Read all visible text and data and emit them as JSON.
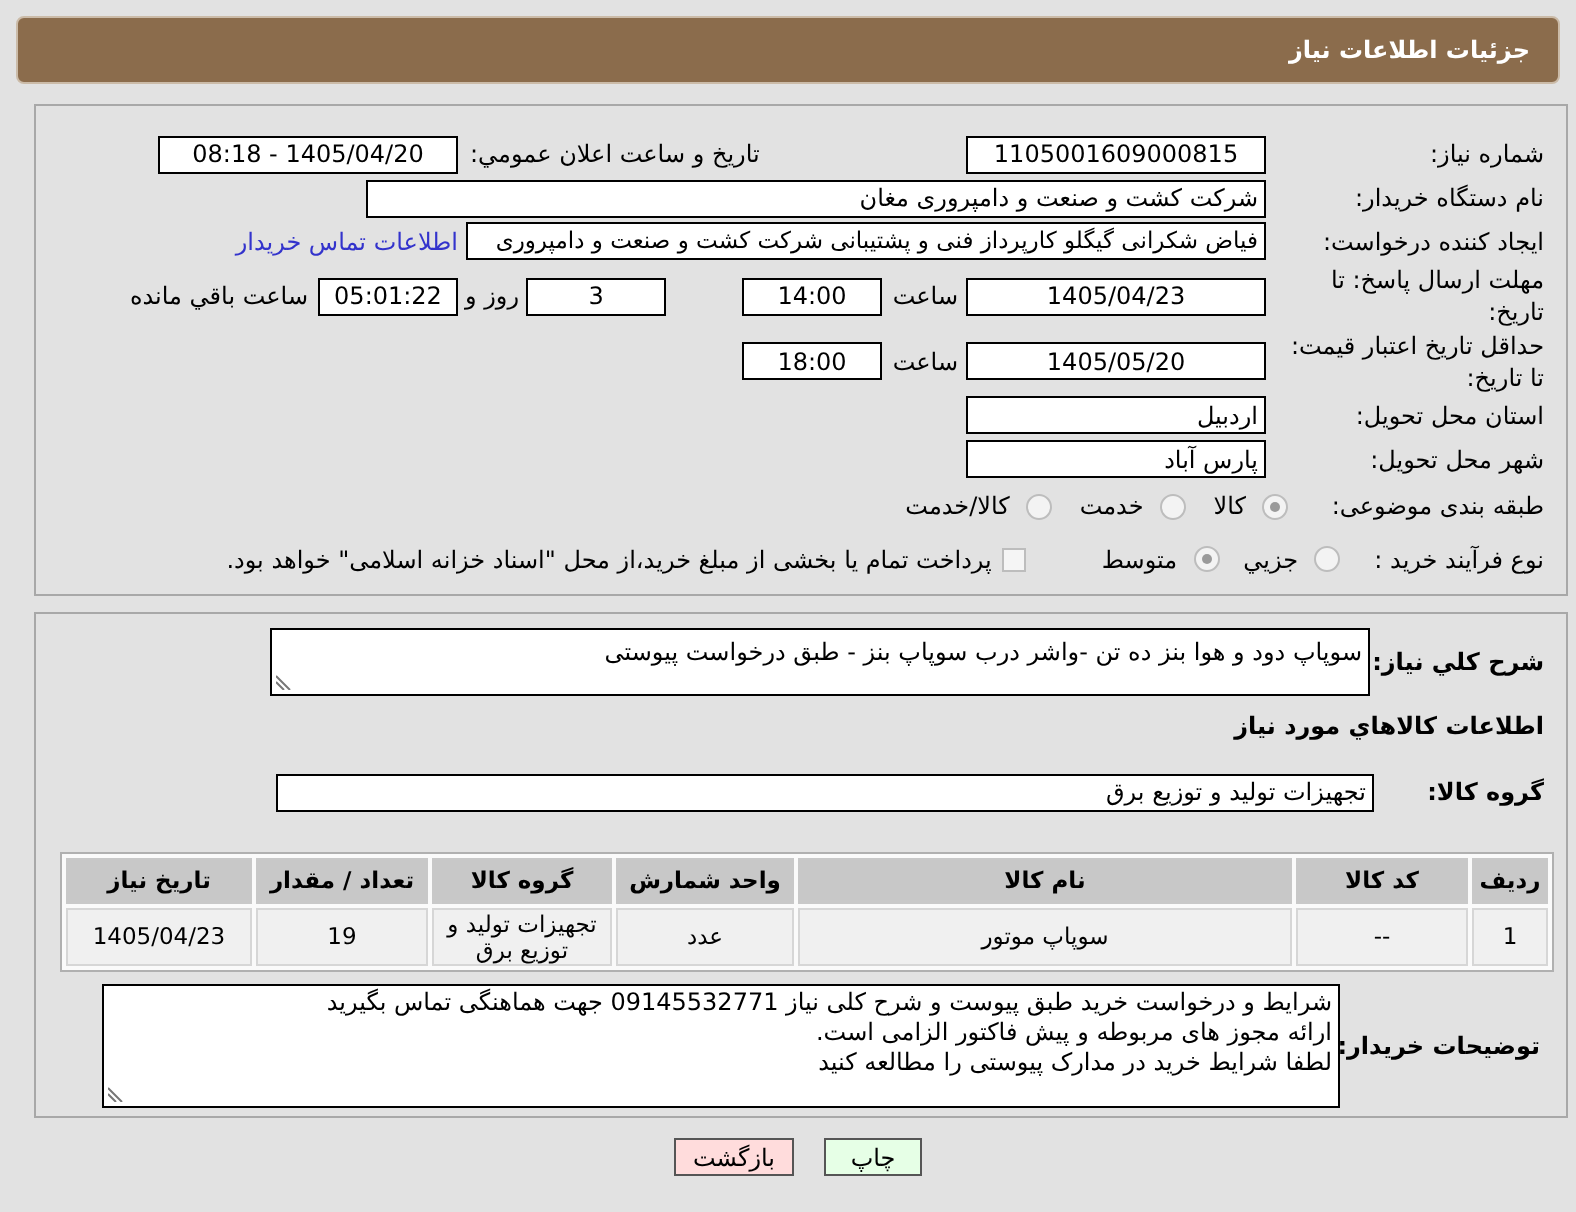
{
  "header": {
    "title": "جزئیات اطلاعات نیاز"
  },
  "details": {
    "need_number": {
      "label": "شماره نیاز:",
      "value": "1105001609000815"
    },
    "announce": {
      "label": "تاریخ و ساعت اعلان عمومي:",
      "value": "1405/04/20 - 08:18"
    },
    "buyer_org": {
      "label": "نام دستگاه خریدار:",
      "value": "شرکت کشت و صنعت و دامپروری مغان"
    },
    "requester": {
      "label": "ایجاد کننده درخواست:",
      "value": "فیاض شکرانی گیگلو کارپرداز فنی و پشتیبانی شرکت کشت و صنعت و دامپروری",
      "link": "اطلاعات تماس خریدار"
    },
    "reply_deadline": {
      "label": "مهلت ارسال پاسخ: تا تاریخ:",
      "date": "1405/04/23",
      "time_label": "ساعت",
      "time": "14:00",
      "days": "3",
      "days_label": "روز و",
      "remaining": "05:01:22",
      "remaining_label": "ساعت باقي مانده"
    },
    "price_validity": {
      "label": "حداقل تاریخ اعتبار قیمت: تا تاریخ:",
      "date": "1405/05/20",
      "time_label": "ساعت",
      "time": "18:00"
    },
    "province": {
      "label": "استان محل تحویل:",
      "value": "اردبیل"
    },
    "city": {
      "label": "شهر محل تحویل:",
      "value": "پارس آباد"
    },
    "category": {
      "label": "طبقه بندی موضوعی:",
      "options": [
        {
          "label": "کالا",
          "selected": true
        },
        {
          "label": "خدمت",
          "selected": false
        },
        {
          "label": "کالا/خدمت",
          "selected": false
        }
      ]
    },
    "process": {
      "label": "نوع فرآیند خرید :",
      "options": [
        {
          "label": "جزيي",
          "selected": false
        },
        {
          "label": "متوسط",
          "selected": true
        }
      ],
      "treasury": {
        "label": "پرداخت تمام یا بخشی از مبلغ خرید،از محل \"اسناد خزانه اسلامی\" خواهد بود.",
        "checked": false
      }
    }
  },
  "description": {
    "label": "شرح کلي نیاز:",
    "value": "سوپاپ دود و هوا بنز ده تن -واشر درب سوپاپ بنز - طبق درخواست پیوستی"
  },
  "items_title": "اطلاعات کالاهاي مورد نیاز",
  "goods_group": {
    "label": "گروه کالا:",
    "value": "تجهیزات تولید و توزیع برق"
  },
  "table": {
    "columns": [
      "ردیف",
      "کد کالا",
      "نام کالا",
      "واحد شمارش",
      "گروه کالا",
      "تعداد / مقدار",
      "تاریخ نیاز"
    ],
    "rows": [
      [
        "1",
        "--",
        "سوپاپ موتور",
        "عدد",
        "تجهیزات تولید و توزیع برق",
        "19",
        "1405/04/23"
      ]
    ]
  },
  "buyer_notes": {
    "label": "توضیحات خریدار:",
    "lines": [
      "شرایط و درخواست خرید طبق پیوست و شرح کلی نیاز 09145532771 جهت هماهنگی تماس بگیرید",
      "ارائه مجوز های مربوطه و پیش فاکتور الزامی است.",
      "لطفا شرایط خرید در مدارک پیوستی را مطالعه کنید"
    ]
  },
  "buttons": [
    {
      "label": "چاپ",
      "kind": "print"
    },
    {
      "label": "بازگشت",
      "kind": "back"
    }
  ]
}
